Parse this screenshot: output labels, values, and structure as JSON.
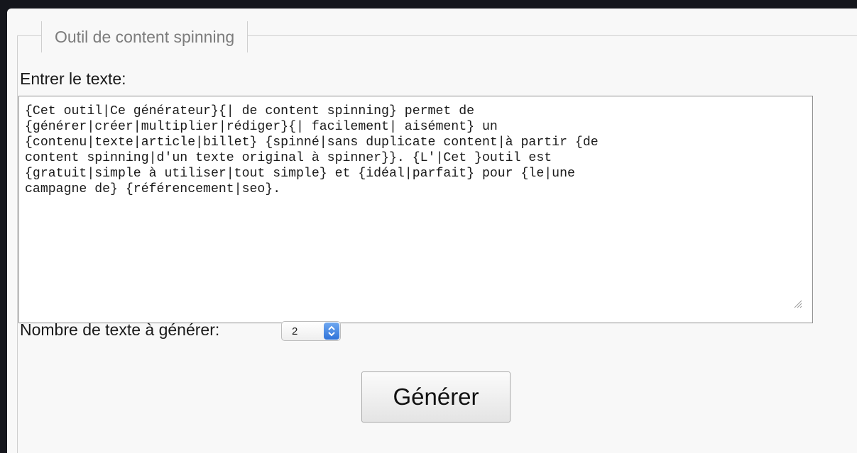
{
  "form": {
    "legend": "Outil de content spinning",
    "text_label": "Entrer le texte:",
    "text_value": "{Cet outil|Ce générateur}{| de content spinning} permet de\n{générer|créer|multiplier|rédiger}{| facilement| aisément} un\n{contenu|texte|article|billet} {spinné|sans duplicate content|à partir {de\ncontent spinning|d'un texte original à spinner}}. {L'|Cet }outil est\n{gratuit|simple à utiliser|tout simple} et {idéal|parfait} pour {le|une\ncampagne de} {référencement|seo}.",
    "count_label": "Nombre de texte à générer:",
    "count_value": "2",
    "submit_label": "Générer"
  },
  "icons": {
    "select_arrow": "updown-chevron-icon",
    "resize": "resize-grip-icon"
  },
  "colors": {
    "select_arrow": "#2f73d9"
  }
}
